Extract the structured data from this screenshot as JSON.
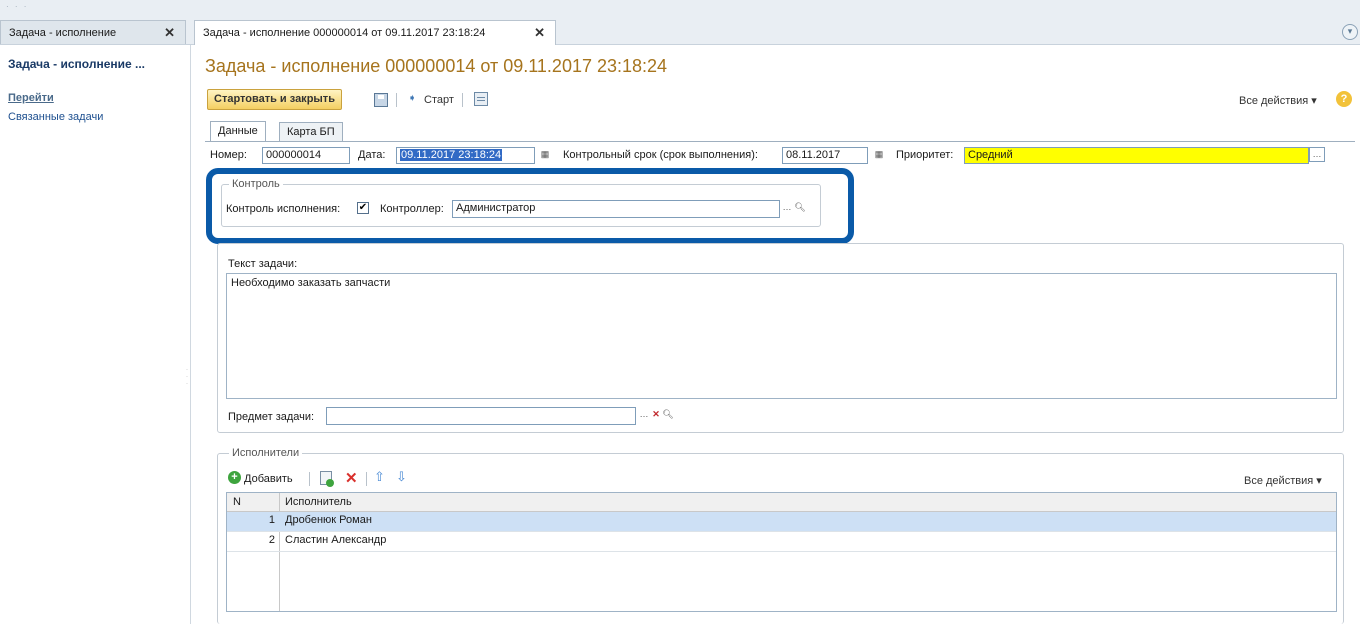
{
  "window_tabs": [
    {
      "label": "Задача - исполнение"
    },
    {
      "label": "Задача - исполнение 000000014 от 09.11.2017 23:18:24"
    }
  ],
  "sidebar": {
    "title": "Задача - исполнение ...",
    "goto_label": "Перейти",
    "links": [
      "Связанные задачи"
    ]
  },
  "form": {
    "title": "Задача - исполнение 000000014 от 09.11.2017 23:18:24",
    "toolbar": {
      "primary_button": "Стартовать и закрыть",
      "start_button": "Старт",
      "all_actions": "Все действия ▾",
      "help": "?"
    },
    "tabs": [
      "Данные",
      "Карта БП"
    ],
    "fields": {
      "number_label": "Номер:",
      "number_value": "000000014",
      "date_label": "Дата:",
      "date_value": "09.11.2017 23:18:24",
      "deadline_label": "Контрольный срок (срок выполнения):",
      "deadline_value": "08.11.2017",
      "priority_label": "Приоритет:",
      "priority_value": "Средний"
    },
    "control_group": {
      "title": "Контроль",
      "execution_control_label": "Контроль исполнения:",
      "execution_control_checked": "✔",
      "controller_label": "Контроллер:",
      "controller_value": "Администратор"
    },
    "task_text_label": "Текст задачи:",
    "task_text_value": "Необходимо заказать запчасти",
    "subject_label": "Предмет задачи:",
    "subject_value": "",
    "executors": {
      "title": "Исполнители",
      "add_button": "Добавить",
      "all_actions": "Все действия ▾",
      "columns": [
        "N",
        "Исполнитель"
      ],
      "rows": [
        {
          "n": "1",
          "name": "Дробенюк Роман"
        },
        {
          "n": "2",
          "name": "Сластин Александр"
        }
      ]
    }
  },
  "colors": {
    "title": "#a6741d",
    "highlight": "#0a5aa8",
    "priority_bg": "#ffff00",
    "selected_row": "#cde0f5"
  }
}
